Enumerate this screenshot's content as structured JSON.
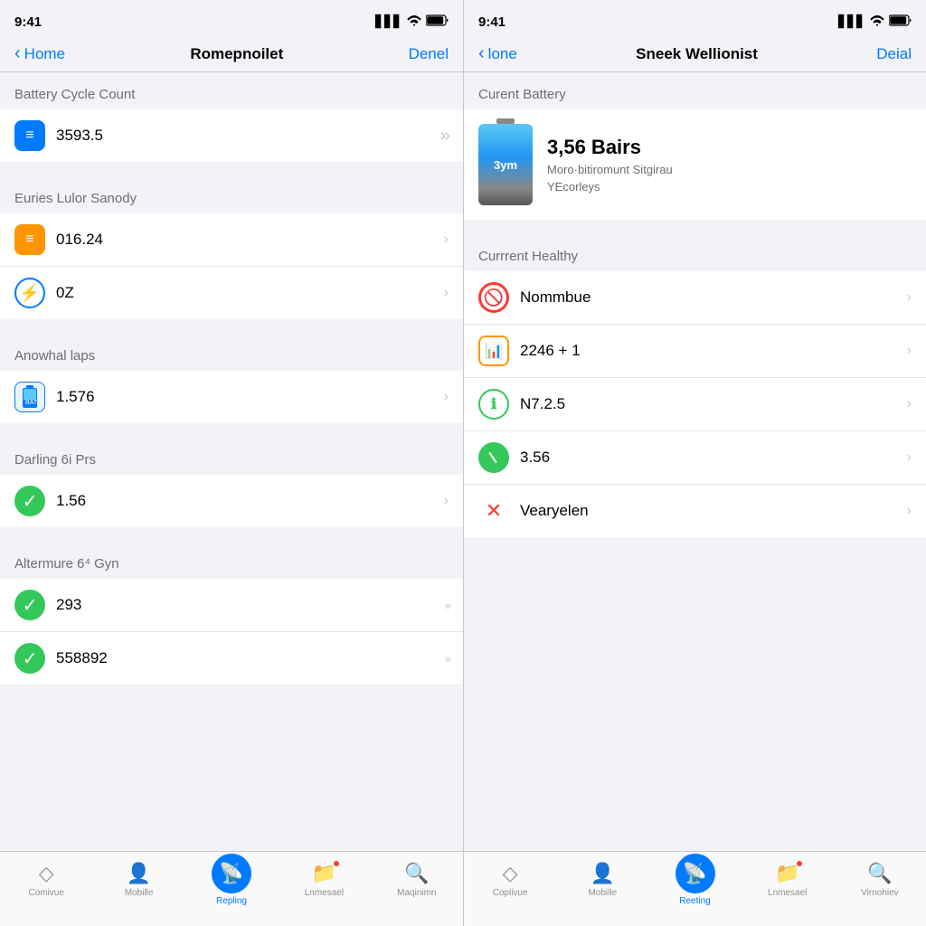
{
  "left_panel": {
    "status": {
      "time": "9:41",
      "signal": "▋▋▋",
      "wifi": "wifi",
      "battery": "🔋"
    },
    "nav": {
      "back_label": "Home",
      "title": "Romepnoilet",
      "action": "Denel"
    },
    "sections": [
      {
        "header": "Battery Cycle Count",
        "items": [
          {
            "icon_type": "blue_square",
            "icon_char": "≡",
            "text": "3593.5",
            "chevron": "›",
            "double": false
          }
        ]
      },
      {
        "header": "Euries Lulor Sanody",
        "items": [
          {
            "icon_type": "orange_square",
            "icon_char": "≡",
            "text": "016.24",
            "chevron": "›",
            "double": false
          },
          {
            "icon_type": "blue_circle",
            "icon_char": "⚡",
            "text": "0Z",
            "chevron": "›",
            "double": false
          }
        ]
      },
      {
        "header": "Anowhal laps",
        "items": [
          {
            "icon_type": "blue_battery",
            "icon_char": "🔋",
            "text": "1.576",
            "chevron": "›",
            "double": false
          }
        ]
      },
      {
        "header": "Darling 6i Prs",
        "items": [
          {
            "icon_type": "green_check",
            "icon_char": "✓",
            "text": "1.56",
            "chevron": "›",
            "double": false
          }
        ]
      },
      {
        "header": "Altermure 6⁴ Gyn",
        "items": [
          {
            "icon_type": "green_check",
            "icon_char": "✓",
            "text": "293",
            "chevron": "»",
            "double": true
          },
          {
            "icon_type": "green_check",
            "icon_char": "✓",
            "text": "558892",
            "chevron": "»",
            "double": true
          }
        ]
      }
    ],
    "tabs": [
      {
        "icon": "◇",
        "label": "Comivue",
        "active": false
      },
      {
        "icon": "👤",
        "label": "Mobille",
        "active": false
      },
      {
        "icon": "❤️",
        "label": "Repling",
        "active": true
      },
      {
        "icon": "📁",
        "label": "Lnmesael",
        "active": false,
        "badge": true
      },
      {
        "icon": "🔍",
        "label": "Maqinimn",
        "active": false
      }
    ]
  },
  "right_panel": {
    "status": {
      "time": "9:41",
      "signal": "▋▋▋",
      "wifi": "wifi",
      "battery": "🔋"
    },
    "nav": {
      "back_label": "lone",
      "title": "Sneek Wellionist",
      "action": "Deial"
    },
    "current_battery": {
      "section_header": "Curent Battery",
      "battery_value": "3,56 Bairs",
      "battery_sub1": "Moro·bitiromunt Sitgirau",
      "battery_sub2": "YEcorleys",
      "battery_label": "3ym"
    },
    "health": {
      "section_header": "Currrent Healthy",
      "items": [
        {
          "icon_type": "no_circle",
          "icon_char": "🚫",
          "text": "Nommbue",
          "chevron": "›"
        },
        {
          "icon_type": "bar_orange",
          "icon_char": "📊",
          "text": "2246 + 1",
          "chevron": "›"
        },
        {
          "icon_type": "circle_green",
          "icon_char": "ℹ",
          "text": "N7.2.5",
          "chevron": "›"
        },
        {
          "icon_type": "slash_green",
          "icon_char": "/",
          "text": "3.56",
          "chevron": "›"
        },
        {
          "icon_type": "x_red",
          "icon_char": "✕",
          "text": "Vearyelen",
          "chevron": "›"
        }
      ]
    },
    "tabs": [
      {
        "icon": "◇",
        "label": "Coplivue",
        "active": false
      },
      {
        "icon": "👤",
        "label": "Mobille",
        "active": false
      },
      {
        "icon": "❤️",
        "label": "Reeting",
        "active": true
      },
      {
        "icon": "📁",
        "label": "Lnmesael",
        "active": false,
        "badge": true
      },
      {
        "icon": "🔍",
        "label": "Virnohiev",
        "active": false
      }
    ]
  }
}
